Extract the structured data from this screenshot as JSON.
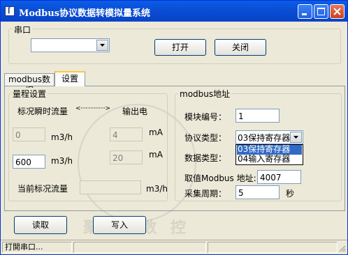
{
  "window": {
    "title": "Modbus协议数据转模拟量系统",
    "icon_glyph": "⌈"
  },
  "serial": {
    "group_label": "串口",
    "port_value": "",
    "open_label": "打开",
    "close_label": "关闭"
  },
  "tabs": [
    {
      "label": "modbus数据",
      "active": false
    },
    {
      "label": "设置",
      "active": true
    }
  ],
  "range": {
    "group_label": "量程设置",
    "header_left": "标况瞬时流量",
    "header_arrow": "<···············>",
    "header_right": "输出电",
    "flow_min": "0",
    "flow_max": "600",
    "flow_unit": "m3/h",
    "ma_min": "4",
    "ma_max": "20",
    "ma_unit": "mA",
    "current_flow_label": "当前标况流量",
    "current_flow_value": "",
    "current_flow_unit": "m3/h"
  },
  "modbus": {
    "group_label": "modbus地址",
    "module_no_label": "模块编号：",
    "module_no_value": "1",
    "protocol_label": "协议类型：",
    "protocol_value": "03保持寄存器",
    "protocol_options": [
      "03保持寄存器",
      "04输入寄存器"
    ],
    "data_type_label": "数据类型：",
    "address_label": "取值Modbus 地址:",
    "address_value": "4007",
    "period_label": "采集周期：",
    "period_value": "5",
    "period_unit": "秒"
  },
  "actions": {
    "read_label": "读取",
    "write_label": "写入"
  },
  "status": {
    "text": "打開串口...",
    "cell2": "",
    "cell3": ""
  },
  "watermark": {
    "text": "聚 一 数 控"
  },
  "colors": {
    "title_bar": "#0a4fd6",
    "selection": "#316ac5",
    "face": "#ece9d8"
  }
}
